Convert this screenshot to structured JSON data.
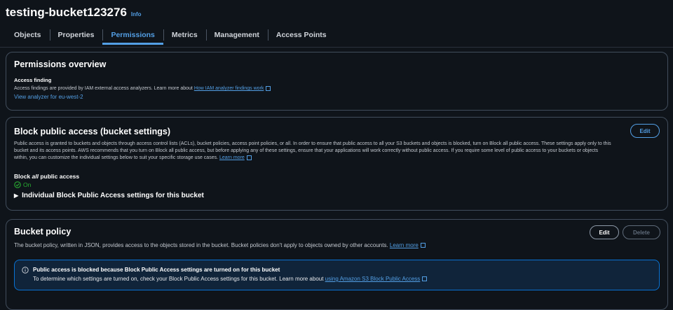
{
  "header": {
    "bucket_name": "testing-bucket123276",
    "info_label": "Info"
  },
  "tabs": [
    "Objects",
    "Properties",
    "Permissions",
    "Metrics",
    "Management",
    "Access Points"
  ],
  "active_tab": "Permissions",
  "permissions_overview": {
    "title": "Permissions overview",
    "access_finding_label": "Access finding",
    "access_finding_text": "Access findings are provided by IAM external access analyzers. Learn more about",
    "access_finding_link": "How IAM analyzer findings work",
    "view_analyzer_link": "View analyzer for eu-west-2"
  },
  "block_public_access": {
    "title": "Block public access (bucket settings)",
    "edit_label": "Edit",
    "description_1": "Public access is granted to buckets and objects through access control lists (ACLs), bucket policies, access point policies, or all. In order to ensure that public access to all your S3 buckets and objects is blocked, turn on Block all public access. These settings apply only to this",
    "description_2": "bucket and its access points. AWS recommends that you turn on Block all public access, but before applying any of these settings, ensure that your applications will work correctly without public access. If you require some level of public access to your buckets or objects",
    "description_3": "within, you can customize the individual settings below to suit your specific storage use cases.",
    "learn_more": "Learn more",
    "block_label_pre": "Block ",
    "block_label_em": "all",
    "block_label_post": " public access",
    "status": "On",
    "individual_settings": "Individual Block Public Access settings for this bucket"
  },
  "bucket_policy": {
    "title": "Bucket policy",
    "edit_label": "Edit",
    "delete_label": "Delete",
    "description": "The bucket policy, written in JSON, provides access to the objects stored in the bucket. Bucket policies don't apply to objects owned by other accounts.",
    "learn_more": "Learn more",
    "alert_title": "Public access is blocked because Block Public Access settings are turned on for this bucket",
    "alert_text": "To determine which settings are turned on, check your Block Public Access settings for this bucket. Learn more about",
    "alert_link": "using Amazon S3 Block Public Access"
  },
  "colors": {
    "accent": "#539fe5",
    "success": "#29ad32",
    "background": "#0f141a",
    "border": "#414d5c"
  }
}
